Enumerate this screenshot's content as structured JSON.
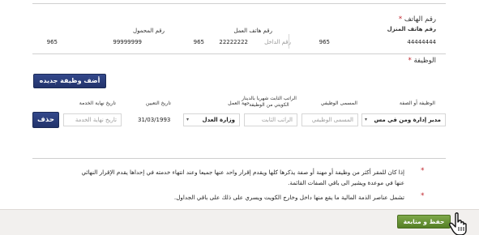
{
  "phone": {
    "section_label": "رقم الهاتف",
    "home_label": "رقم هاتف المنزل",
    "home_value": "44444444",
    "work_label": "رقم هاتف العمل",
    "work_ext_placeholder": "رقم الداخل",
    "work_value": "22222222",
    "work_code": "965",
    "mobile_label": "رقم المحمول",
    "mobile_value": "99999999",
    "mobile_code": "965",
    "home_code": "965"
  },
  "jobs": {
    "section_label": "الوظيفة",
    "add_button": "أضف وظيفة جديده",
    "headers": {
      "job_or_title": "الوظيفة أو الصفة",
      "job_name": "المسمى الوظيفي",
      "salary": "الراتب الثابت شهريا بالدينار الكويتي من الوظيفة",
      "employer": "جهة العمل",
      "appointment_date": "تاريخ التعيين",
      "end_date": "تاريخ نهاية الخدمة"
    },
    "row": {
      "job_or_title_value": "مدير إدارة ومن في مس",
      "job_name_placeholder": "المسمى الوظيفي",
      "salary_placeholder": "الراتب الثابت",
      "employer_value": "وزارة العدل",
      "appointment_date_value": "31/03/1993",
      "end_date_placeholder": "تاريخ نهاية الخدمة",
      "delete_button": "حذف"
    }
  },
  "notes": {
    "note1_line1": "إذا كان للمقر أكثر من وظيفة أو مهنة أو صفة يذكرها كلها ويقدم إقرار واحد عنها جميعا وعند انتهاء خدمته في إحداها يقدم الإقرار النهائي",
    "note1_line2": "عنها في موعدة ويشير الى باقي الصفات القائمة.",
    "note2": "تشمل عناصر الذمة المالية ما يقع منها داخل وخارج الكويت ويسري على ذلك على باقي الجداول."
  },
  "footer": {
    "save_button": "حفظ و متابعة"
  },
  "colors": {
    "navy": "#2a3c78",
    "green": "#6a9536",
    "required": "#c0262d"
  }
}
